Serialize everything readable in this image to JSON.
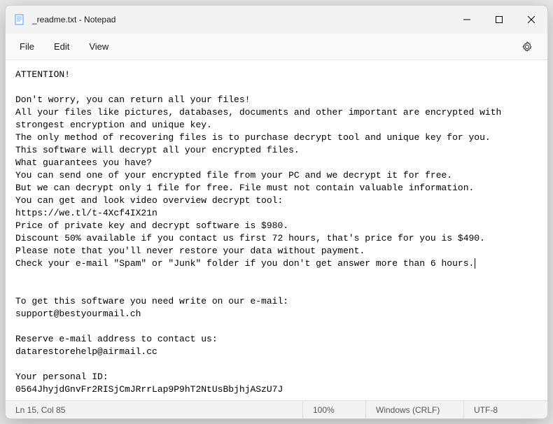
{
  "titlebar": {
    "filename": "_readme.txt",
    "appname": "Notepad"
  },
  "menu": {
    "file": "File",
    "edit": "Edit",
    "view": "View"
  },
  "content": {
    "line1": "ATTENTION!",
    "line2": "",
    "line3": "Don't worry, you can return all your files!",
    "line4": "All your files like pictures, databases, documents and other important are encrypted with strongest encryption and unique key.",
    "line5": "The only method of recovering files is to purchase decrypt tool and unique key for you.",
    "line6": "This software will decrypt all your encrypted files.",
    "line7": "What guarantees you have?",
    "line8": "You can send one of your encrypted file from your PC and we decrypt it for free.",
    "line9": "But we can decrypt only 1 file for free. File must not contain valuable information.",
    "line10": "You can get and look video overview decrypt tool:",
    "line11": "https://we.tl/t-4Xcf4IX21n",
    "line12": "Price of private key and decrypt software is $980.",
    "line13": "Discount 50% available if you contact us first 72 hours, that's price for you is $490.",
    "line14": "Please note that you'll never restore your data without payment.",
    "line15": "Check your e-mail \"Spam\" or \"Junk\" folder if you don't get answer more than 6 hours.",
    "line16": "",
    "line17": "",
    "line18": "To get this software you need write on our e-mail:",
    "line19": "support@bestyourmail.ch",
    "line20": "",
    "line21": "Reserve e-mail address to contact us:",
    "line22": "datarestorehelp@airmail.cc",
    "line23": "",
    "line24": "Your personal ID:",
    "line25": "0564JhyjdGnvFr2RISjCmJRrrLap9P9hT2NtUsBbjhjASzU7J"
  },
  "statusbar": {
    "position": "Ln 15, Col 85",
    "zoom": "100%",
    "lineending": "Windows (CRLF)",
    "encoding": "UTF-8"
  }
}
